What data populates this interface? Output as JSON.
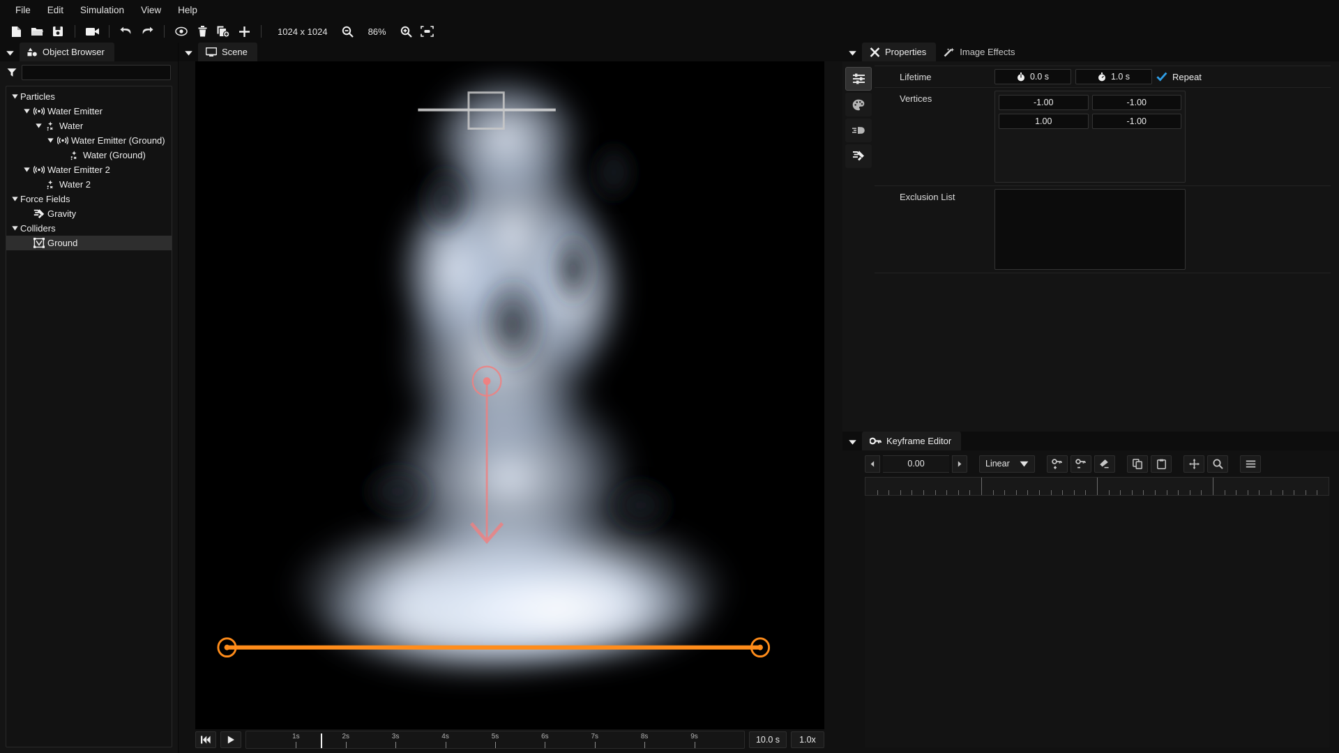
{
  "menubar": {
    "items": [
      {
        "label": "File"
      },
      {
        "label": "Edit"
      },
      {
        "label": "Simulation"
      },
      {
        "label": "View"
      },
      {
        "label": "Help"
      }
    ]
  },
  "toolbar": {
    "buttons": [
      {
        "name": "new-file-icon"
      },
      {
        "name": "open-folder-icon"
      },
      {
        "name": "save-icon"
      },
      {
        "name": "render-video-icon"
      },
      {
        "name": "undo-icon"
      },
      {
        "name": "redo-icon"
      },
      {
        "name": "preview-eye-icon"
      },
      {
        "name": "delete-trash-icon"
      },
      {
        "name": "duplicate-icon"
      },
      {
        "name": "add-plus-icon"
      }
    ],
    "resolution": "1024 x 1024",
    "zoom_out_icon": "zoom-out-icon",
    "zoom_level": "86%",
    "zoom_in_icon": "zoom-in-icon",
    "fit_icon": "fit-to-screen-icon"
  },
  "object_browser": {
    "tab_label": "Object Browser",
    "tab_icon": "object-browser-icon",
    "filter_icon": "filter-funnel-icon",
    "filter_value": "",
    "filter_placeholder": "",
    "tree": [
      {
        "label": "Particles",
        "depth": 0,
        "expanded": true,
        "icon": "",
        "selected": false
      },
      {
        "label": "Water Emitter",
        "depth": 1,
        "expanded": true,
        "icon": "emitter-icon",
        "selected": false
      },
      {
        "label": "Water",
        "depth": 2,
        "expanded": true,
        "icon": "particle-icon",
        "selected": false
      },
      {
        "label": "Water Emitter (Ground)",
        "depth": 3,
        "expanded": true,
        "icon": "emitter-icon",
        "selected": false
      },
      {
        "label": "Water (Ground)",
        "depth": 4,
        "expanded": null,
        "icon": "particle-icon",
        "selected": false
      },
      {
        "label": "Water Emitter 2",
        "depth": 1,
        "expanded": true,
        "icon": "emitter-icon",
        "selected": false
      },
      {
        "label": "Water 2",
        "depth": 2,
        "expanded": null,
        "icon": "particle-icon",
        "selected": false
      },
      {
        "label": "Force Fields",
        "depth": 0,
        "expanded": true,
        "icon": "",
        "selected": false
      },
      {
        "label": "Gravity",
        "depth": 1,
        "expanded": null,
        "icon": "gravity-icon",
        "selected": false
      },
      {
        "label": "Colliders",
        "depth": 0,
        "expanded": true,
        "icon": "",
        "selected": false
      },
      {
        "label": "Ground",
        "depth": 1,
        "expanded": null,
        "icon": "collider-icon",
        "selected": true
      }
    ]
  },
  "scene": {
    "tab_label": "Scene",
    "tab_icon": "monitor-icon",
    "gizmos": {
      "emitter_line_color": "#d8d8d8",
      "gravity_arrow_color": "#f08080",
      "collider_line_color": "#ff8c1a"
    }
  },
  "playback": {
    "rewind_icon": "rewind-to-start-icon",
    "play_icon": "play-icon",
    "ticks": [
      "1s",
      "2s",
      "3s",
      "4s",
      "5s",
      "6s",
      "7s",
      "8s",
      "9s"
    ],
    "playhead_time": "1.5s",
    "duration": "10.0 s",
    "speed": "1.0x"
  },
  "properties": {
    "caret_icon": "panel-caret-icon",
    "tabs": [
      {
        "label": "Properties",
        "icon": "properties-icon",
        "active": true
      },
      {
        "label": "Image Effects",
        "icon": "image-effects-icon",
        "active": false
      }
    ],
    "rail": [
      {
        "name": "sliders-icon",
        "active": true
      },
      {
        "name": "palette-icon",
        "active": false
      },
      {
        "name": "motion-icon",
        "active": false
      },
      {
        "name": "physics-icon",
        "active": false
      }
    ],
    "rows": [
      {
        "label": "Lifetime",
        "type": "lifetime",
        "start_icon": "stopwatch-start-icon",
        "start_value": "0.0 s",
        "end_icon": "stopwatch-end-icon",
        "end_value": "1.0 s",
        "repeat_label": "Repeat",
        "repeat_checked": true,
        "check_color": "#2f9fe8"
      },
      {
        "label": "Vertices",
        "type": "vertices",
        "values": [
          [
            "-1.00",
            "-1.00"
          ],
          [
            "1.00",
            "-1.00"
          ]
        ]
      },
      {
        "label": "Exclusion List",
        "type": "listbox",
        "items": []
      }
    ]
  },
  "keyframe_editor": {
    "caret_icon": "panel-caret-icon",
    "tab_label": "Keyframe Editor",
    "tab_icon": "key-icon",
    "prev_icon": "step-prev-icon",
    "value": "0.00",
    "next_icon": "step-next-icon",
    "interpolation": "Linear",
    "dropdown_icon": "chevron-down-icon",
    "buttons": [
      {
        "name": "add-keyframe-icon"
      },
      {
        "name": "remove-keyframe-icon"
      },
      {
        "name": "erase-keyframes-icon"
      },
      {
        "name": "copy-icon"
      },
      {
        "name": "paste-icon"
      },
      {
        "name": "pan-icon"
      },
      {
        "name": "zoom-icon"
      },
      {
        "name": "menu-icon"
      }
    ]
  }
}
